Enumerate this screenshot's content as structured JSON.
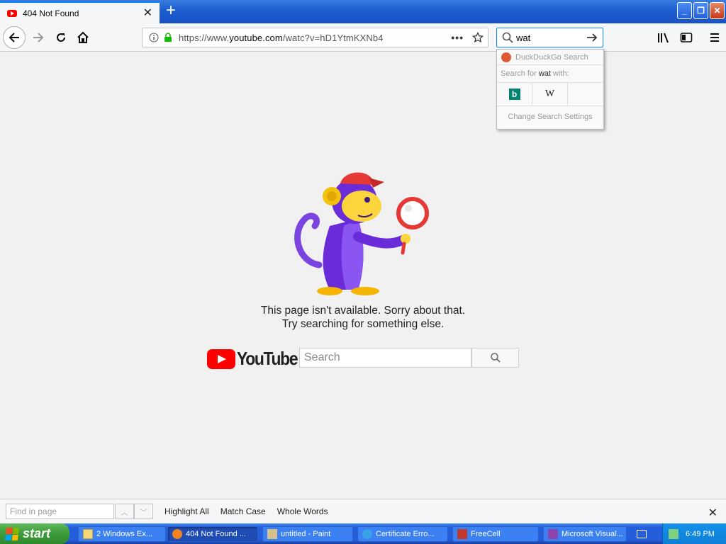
{
  "browser": {
    "tab_title": "404 Not Found",
    "url_prefix": "https://www.",
    "url_domain": "youtube.com",
    "url_path": "/watc?v=hD1YtmKXNb4",
    "search_value": "wat"
  },
  "search_dropdown": {
    "engine": "DuckDuckGo Search",
    "search_for_prefix": "Search for ",
    "search_term": "wat",
    "search_for_suffix": " with:",
    "bing_label": "b",
    "wiki_label": "W",
    "settings": "Change Search Settings"
  },
  "page": {
    "message_line1": "This page isn't available. Sorry about that.",
    "message_line2": "Try searching for something else.",
    "logo_text": "YouTube",
    "search_placeholder": "Search"
  },
  "findbar": {
    "placeholder": "Find in page",
    "highlight_all": "Highlight All",
    "match_case": "Match Case",
    "whole_words": "Whole Words"
  },
  "taskbar": {
    "start": "start",
    "tasks": [
      {
        "label": "2 Windows Ex..."
      },
      {
        "label": "404 Not Found ..."
      },
      {
        "label": "untitled - Paint"
      },
      {
        "label": "Certificate Erro..."
      },
      {
        "label": "FreeCell"
      },
      {
        "label": "Microsoft Visual..."
      }
    ],
    "clock": "6:49 PM"
  },
  "colors": {
    "youtube_red": "#ff0000",
    "xp_blue": "#245edb",
    "start_green": "#3c9a3a"
  }
}
